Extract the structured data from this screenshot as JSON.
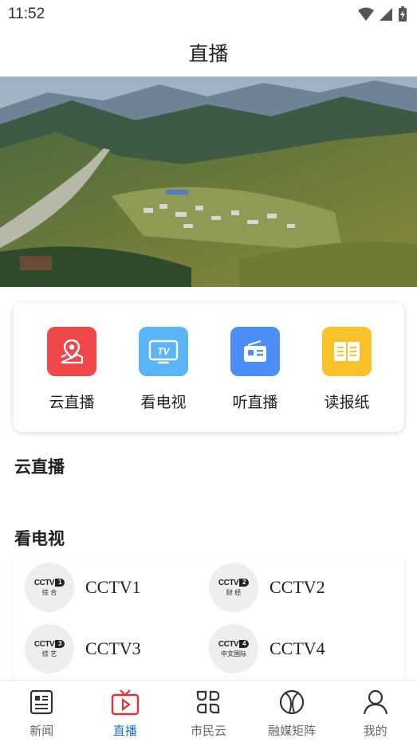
{
  "status_bar": {
    "time": "11:52"
  },
  "header": {
    "title": "直播"
  },
  "quick_entries": [
    {
      "label": "云直播",
      "icon": "location-map-icon",
      "color": "#f0474a"
    },
    {
      "label": "看电视",
      "icon": "tv-icon",
      "color": "#5ab4f6"
    },
    {
      "label": "听直播",
      "icon": "radio-icon",
      "color": "#4c8ef7"
    },
    {
      "label": "读报纸",
      "icon": "newspaper-icon",
      "color": "#f9c22a"
    }
  ],
  "sections": {
    "cloud_live": {
      "title": "云直播"
    },
    "watch_tv": {
      "title": "看电视"
    }
  },
  "tv_channels": [
    {
      "name": "CCTV1",
      "logo_num": "1",
      "logo_sub": "综 合"
    },
    {
      "name": "CCTV2",
      "logo_num": "2",
      "logo_sub": "财 经"
    },
    {
      "name": "CCTV3",
      "logo_num": "3",
      "logo_sub": "综 艺"
    },
    {
      "name": "CCTV4",
      "logo_num": "4",
      "logo_sub": "中文国际"
    }
  ],
  "tv_logo_text": "CCTV",
  "bottom_nav": [
    {
      "label": "新闻",
      "icon": "news-icon",
      "active": false
    },
    {
      "label": "直播",
      "icon": "live-tv-icon",
      "active": true
    },
    {
      "label": "市民云",
      "icon": "grid-icon",
      "active": false
    },
    {
      "label": "融媒矩阵",
      "icon": "media-matrix-icon",
      "active": false
    },
    {
      "label": "我的",
      "icon": "profile-icon",
      "active": false
    }
  ],
  "colors": {
    "active": "#1d6fd2",
    "active_icon": "#e0322e",
    "inactive": "#666666"
  }
}
